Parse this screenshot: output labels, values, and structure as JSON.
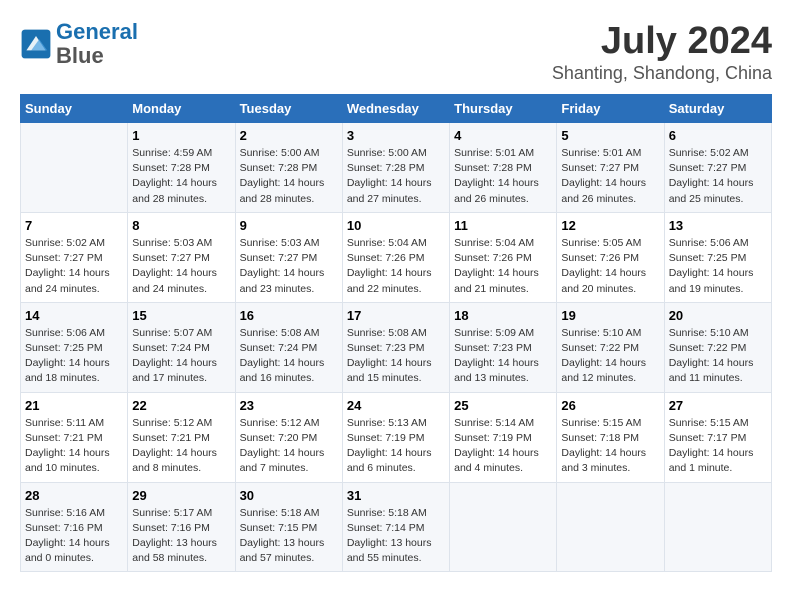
{
  "logo": {
    "line1": "General",
    "line2": "Blue"
  },
  "title": "July 2024",
  "subtitle": "Shanting, Shandong, China",
  "days_header": [
    "Sunday",
    "Monday",
    "Tuesday",
    "Wednesday",
    "Thursday",
    "Friday",
    "Saturday"
  ],
  "weeks": [
    [
      {
        "num": "",
        "info": ""
      },
      {
        "num": "1",
        "info": "Sunrise: 4:59 AM\nSunset: 7:28 PM\nDaylight: 14 hours\nand 28 minutes."
      },
      {
        "num": "2",
        "info": "Sunrise: 5:00 AM\nSunset: 7:28 PM\nDaylight: 14 hours\nand 28 minutes."
      },
      {
        "num": "3",
        "info": "Sunrise: 5:00 AM\nSunset: 7:28 PM\nDaylight: 14 hours\nand 27 minutes."
      },
      {
        "num": "4",
        "info": "Sunrise: 5:01 AM\nSunset: 7:28 PM\nDaylight: 14 hours\nand 26 minutes."
      },
      {
        "num": "5",
        "info": "Sunrise: 5:01 AM\nSunset: 7:27 PM\nDaylight: 14 hours\nand 26 minutes."
      },
      {
        "num": "6",
        "info": "Sunrise: 5:02 AM\nSunset: 7:27 PM\nDaylight: 14 hours\nand 25 minutes."
      }
    ],
    [
      {
        "num": "7",
        "info": "Sunrise: 5:02 AM\nSunset: 7:27 PM\nDaylight: 14 hours\nand 24 minutes."
      },
      {
        "num": "8",
        "info": "Sunrise: 5:03 AM\nSunset: 7:27 PM\nDaylight: 14 hours\nand 24 minutes."
      },
      {
        "num": "9",
        "info": "Sunrise: 5:03 AM\nSunset: 7:27 PM\nDaylight: 14 hours\nand 23 minutes."
      },
      {
        "num": "10",
        "info": "Sunrise: 5:04 AM\nSunset: 7:26 PM\nDaylight: 14 hours\nand 22 minutes."
      },
      {
        "num": "11",
        "info": "Sunrise: 5:04 AM\nSunset: 7:26 PM\nDaylight: 14 hours\nand 21 minutes."
      },
      {
        "num": "12",
        "info": "Sunrise: 5:05 AM\nSunset: 7:26 PM\nDaylight: 14 hours\nand 20 minutes."
      },
      {
        "num": "13",
        "info": "Sunrise: 5:06 AM\nSunset: 7:25 PM\nDaylight: 14 hours\nand 19 minutes."
      }
    ],
    [
      {
        "num": "14",
        "info": "Sunrise: 5:06 AM\nSunset: 7:25 PM\nDaylight: 14 hours\nand 18 minutes."
      },
      {
        "num": "15",
        "info": "Sunrise: 5:07 AM\nSunset: 7:24 PM\nDaylight: 14 hours\nand 17 minutes."
      },
      {
        "num": "16",
        "info": "Sunrise: 5:08 AM\nSunset: 7:24 PM\nDaylight: 14 hours\nand 16 minutes."
      },
      {
        "num": "17",
        "info": "Sunrise: 5:08 AM\nSunset: 7:23 PM\nDaylight: 14 hours\nand 15 minutes."
      },
      {
        "num": "18",
        "info": "Sunrise: 5:09 AM\nSunset: 7:23 PM\nDaylight: 14 hours\nand 13 minutes."
      },
      {
        "num": "19",
        "info": "Sunrise: 5:10 AM\nSunset: 7:22 PM\nDaylight: 14 hours\nand 12 minutes."
      },
      {
        "num": "20",
        "info": "Sunrise: 5:10 AM\nSunset: 7:22 PM\nDaylight: 14 hours\nand 11 minutes."
      }
    ],
    [
      {
        "num": "21",
        "info": "Sunrise: 5:11 AM\nSunset: 7:21 PM\nDaylight: 14 hours\nand 10 minutes."
      },
      {
        "num": "22",
        "info": "Sunrise: 5:12 AM\nSunset: 7:21 PM\nDaylight: 14 hours\nand 8 minutes."
      },
      {
        "num": "23",
        "info": "Sunrise: 5:12 AM\nSunset: 7:20 PM\nDaylight: 14 hours\nand 7 minutes."
      },
      {
        "num": "24",
        "info": "Sunrise: 5:13 AM\nSunset: 7:19 PM\nDaylight: 14 hours\nand 6 minutes."
      },
      {
        "num": "25",
        "info": "Sunrise: 5:14 AM\nSunset: 7:19 PM\nDaylight: 14 hours\nand 4 minutes."
      },
      {
        "num": "26",
        "info": "Sunrise: 5:15 AM\nSunset: 7:18 PM\nDaylight: 14 hours\nand 3 minutes."
      },
      {
        "num": "27",
        "info": "Sunrise: 5:15 AM\nSunset: 7:17 PM\nDaylight: 14 hours\nand 1 minute."
      }
    ],
    [
      {
        "num": "28",
        "info": "Sunrise: 5:16 AM\nSunset: 7:16 PM\nDaylight: 14 hours\nand 0 minutes."
      },
      {
        "num": "29",
        "info": "Sunrise: 5:17 AM\nSunset: 7:16 PM\nDaylight: 13 hours\nand 58 minutes."
      },
      {
        "num": "30",
        "info": "Sunrise: 5:18 AM\nSunset: 7:15 PM\nDaylight: 13 hours\nand 57 minutes."
      },
      {
        "num": "31",
        "info": "Sunrise: 5:18 AM\nSunset: 7:14 PM\nDaylight: 13 hours\nand 55 minutes."
      },
      {
        "num": "",
        "info": ""
      },
      {
        "num": "",
        "info": ""
      },
      {
        "num": "",
        "info": ""
      }
    ]
  ]
}
